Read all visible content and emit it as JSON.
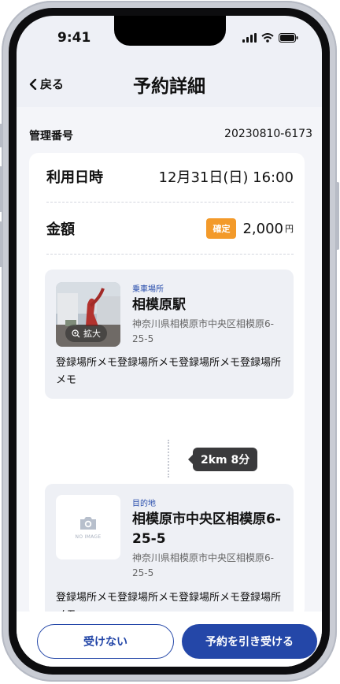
{
  "status_bar": {
    "time": "9:41"
  },
  "nav": {
    "back_label": "戻る",
    "title": "予約詳細"
  },
  "management": {
    "label": "管理番号",
    "value": "20230810-6173"
  },
  "reservation": {
    "datetime_label": "利用日時",
    "datetime_value": "12月31日(日) 16:00",
    "amount_label": "金額",
    "status_badge": "確定",
    "amount_value": "2,000",
    "amount_unit": "円"
  },
  "pickup": {
    "category": "乗車場所",
    "name": "相模原駅",
    "address": "神奈川県相模原市中央区相模原6-25-5",
    "zoom_label": "拡大",
    "memo": "登録場所メモ登録場所メモ登録場所メモ登録場所メモ"
  },
  "route": {
    "distance_time": "2km 8分"
  },
  "destination": {
    "category": "目的地",
    "name": "相模原市中央区相模原6-25-5",
    "address": "神奈川県相模原市中央区相模原6-25-5",
    "no_image_label": "NO IMAGE",
    "memo": "登録場所メモ登録場所メモ登録場所メモ登録場所メモ"
  },
  "actions": {
    "decline_label": "受けない",
    "accept_label": "予約を引き受ける"
  },
  "colors": {
    "primary": "#2447a8",
    "badge": "#f39a2a",
    "distance_tooltip": "#3a3a3c",
    "background": "#f4f5f9"
  },
  "icons": {
    "back": "chevron-left-icon",
    "zoom": "zoom-in-icon",
    "no_image": "camera-icon",
    "signal": "cellular-signal-icon",
    "wifi": "wifi-icon",
    "battery": "battery-icon"
  }
}
